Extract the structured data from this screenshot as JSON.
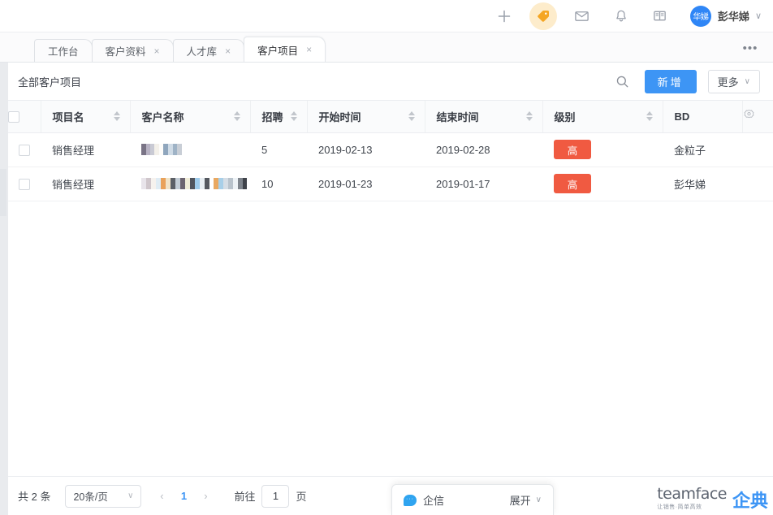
{
  "topbar": {
    "icons": [
      {
        "name": "plus-icon",
        "glyph": "+"
      },
      {
        "name": "tag-icon",
        "glyph": "tag"
      },
      {
        "name": "mail-icon",
        "glyph": "mail"
      },
      {
        "name": "bell-icon",
        "glyph": "bell"
      },
      {
        "name": "book-icon",
        "glyph": "book"
      }
    ],
    "avatar_text": "华娣",
    "user_name": "彭华娣",
    "user_caret": "∨",
    "avatar_color": "#2f86f6",
    "tag_highlight_color": "#fdeccb"
  },
  "tabbar": {
    "tabs": [
      {
        "label": "工作台",
        "closable": false,
        "active": false
      },
      {
        "label": "客户资料",
        "closable": true,
        "active": false
      },
      {
        "label": "人才库",
        "closable": true,
        "active": false
      },
      {
        "label": "客户项目",
        "closable": true,
        "active": true
      }
    ],
    "close_glyph": "×",
    "more_glyph": "•••"
  },
  "toolbar": {
    "title": "全部客户项目",
    "search_icon": "search-icon",
    "add_label": "新增",
    "more_label": "更多",
    "more_caret": "∨",
    "primary_color": "#3d95f5"
  },
  "table": {
    "columns": [
      {
        "key": "check",
        "label": "",
        "sortable": false
      },
      {
        "key": "proj",
        "label": "项目名",
        "sortable": true
      },
      {
        "key": "cust",
        "label": "客户名称",
        "sortable": true
      },
      {
        "key": "hire",
        "label": "招聘",
        "sortable": true
      },
      {
        "key": "start",
        "label": "开始时间",
        "sortable": true
      },
      {
        "key": "end",
        "label": "结束时间",
        "sortable": true
      },
      {
        "key": "level",
        "label": "级别",
        "sortable": true
      },
      {
        "key": "bd",
        "label": "BD",
        "sortable": false
      },
      {
        "key": "gear",
        "label": "",
        "sortable": false
      }
    ],
    "settings_icon": "gear-icon",
    "rows": [
      {
        "project": "销售经理",
        "customer_redacted": true,
        "customer_mosaic_width": 40,
        "hire": "5",
        "start": "2019-02-13",
        "end": "2019-02-28",
        "level": "高",
        "level_color": "#f05a41",
        "bd": "金粒子"
      },
      {
        "project": "销售经理",
        "customer_redacted": true,
        "customer_mosaic_width": 118,
        "hire": "10",
        "start": "2019-01-23",
        "end": "2019-01-17",
        "level": "高",
        "level_color": "#f05a41",
        "bd": "彭华娣"
      }
    ]
  },
  "pagination": {
    "total_text": "共 2 条",
    "page_size": "20条/页",
    "page_size_caret": "∨",
    "prev_glyph": "‹",
    "next_glyph": "›",
    "current_page": "1",
    "goto_label": "前往",
    "goto_value": "1",
    "page_unit": "页"
  },
  "chat": {
    "icon": "chat-bubble-icon",
    "label": "企信",
    "expand_label": "展开",
    "expand_caret": "∨"
  },
  "watermark": {
    "brand": "teamface",
    "tagline": "让销售·简单高效",
    "cn": "企典",
    "brand_color": "#5d6470",
    "cn_color": "#3d95f5"
  }
}
